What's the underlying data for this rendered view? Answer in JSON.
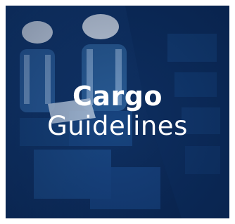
{
  "card": {
    "title_line1": "Cargo",
    "title_line2": "Guidelines",
    "background_image": "warehouse-workers-photo",
    "tint_color": "#0e3b7a",
    "text_color": "#ffffff"
  }
}
